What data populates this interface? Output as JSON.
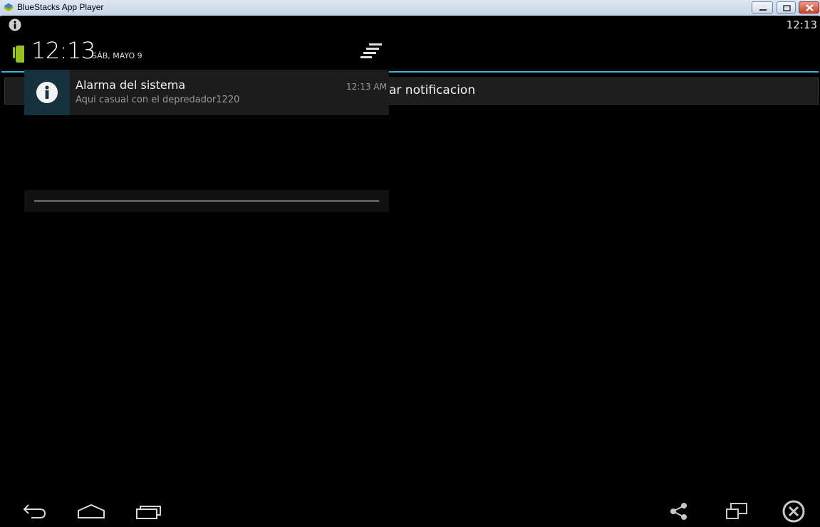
{
  "window": {
    "title": "BlueStacks App Player"
  },
  "status_bar": {
    "time": "12:13"
  },
  "background_app": {
    "button_label": "ar notificacion",
    "accent_color": "#33b5e5"
  },
  "notification_shade": {
    "clock": "12:13",
    "date": "SÁB, MAYO 9",
    "notifications": [
      {
        "title": "Alarma del sistema",
        "text": "Aqui casual con el depredador1220",
        "time": "12:13 AM",
        "icon": "info-icon"
      }
    ]
  },
  "nav_bar": {
    "left": [
      "back-icon",
      "home-icon",
      "recent-apps-icon"
    ],
    "right": [
      "share-icon",
      "screen-rotate-icon",
      "close-app-icon"
    ]
  }
}
